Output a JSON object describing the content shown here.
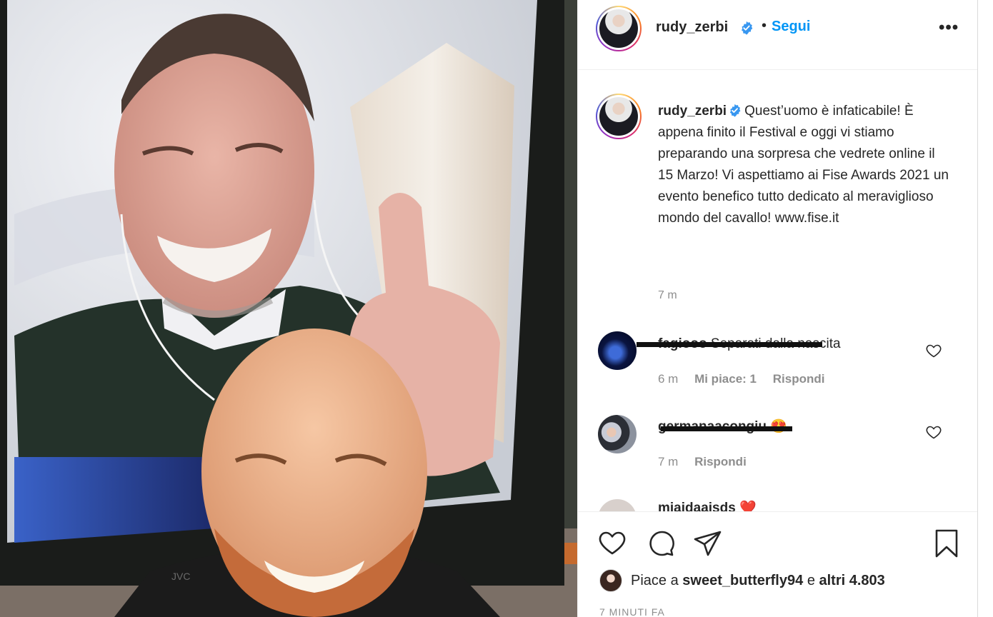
{
  "post": {
    "author": {
      "username": "rudy_zerbi",
      "verified": true,
      "follow_separator": "•",
      "follow_label": "Segui",
      "more_label": "•••"
    },
    "caption": {
      "username": "rudy_zerbi",
      "text": "Quest’uomo è infaticabile! È appena finito il Festival e oggi vi stiamo preparando una sorpresa che vedrete online il 15 Marzo! Vi aspettiamo ai Fise Awards 2021 un evento benefico tutto dedicato al meraviglioso mondo del cavallo! www.fise.it",
      "time": "7 m"
    },
    "comments": [
      {
        "username": "fagiooo",
        "text": "Separati dalla nascita",
        "time": "6 m",
        "likes_label": "Mi piace: 1",
        "reply_label": "Rispondi"
      },
      {
        "username": "germanaacongiu",
        "text": "😍",
        "time": "7 m",
        "reply_label": "Rispondi"
      },
      {
        "username": "miaidaaisds",
        "text": "❤️"
      }
    ],
    "likes": {
      "prefix": "Piace a ",
      "user": "sweet_butterfly94",
      "middle": " e ",
      "others": "altri 4.803"
    },
    "timestamp": "7 MINUTI FA",
    "photo_tv_brand": "JVC",
    "colors": {
      "accent": "#0095f6",
      "verified": "#3897f0",
      "text": "#262626",
      "muted": "#8e8e8e"
    },
    "icons": [
      "heart-icon",
      "comment-icon",
      "share-icon",
      "bookmark-icon",
      "more-icon",
      "verified-badge-icon"
    ]
  }
}
